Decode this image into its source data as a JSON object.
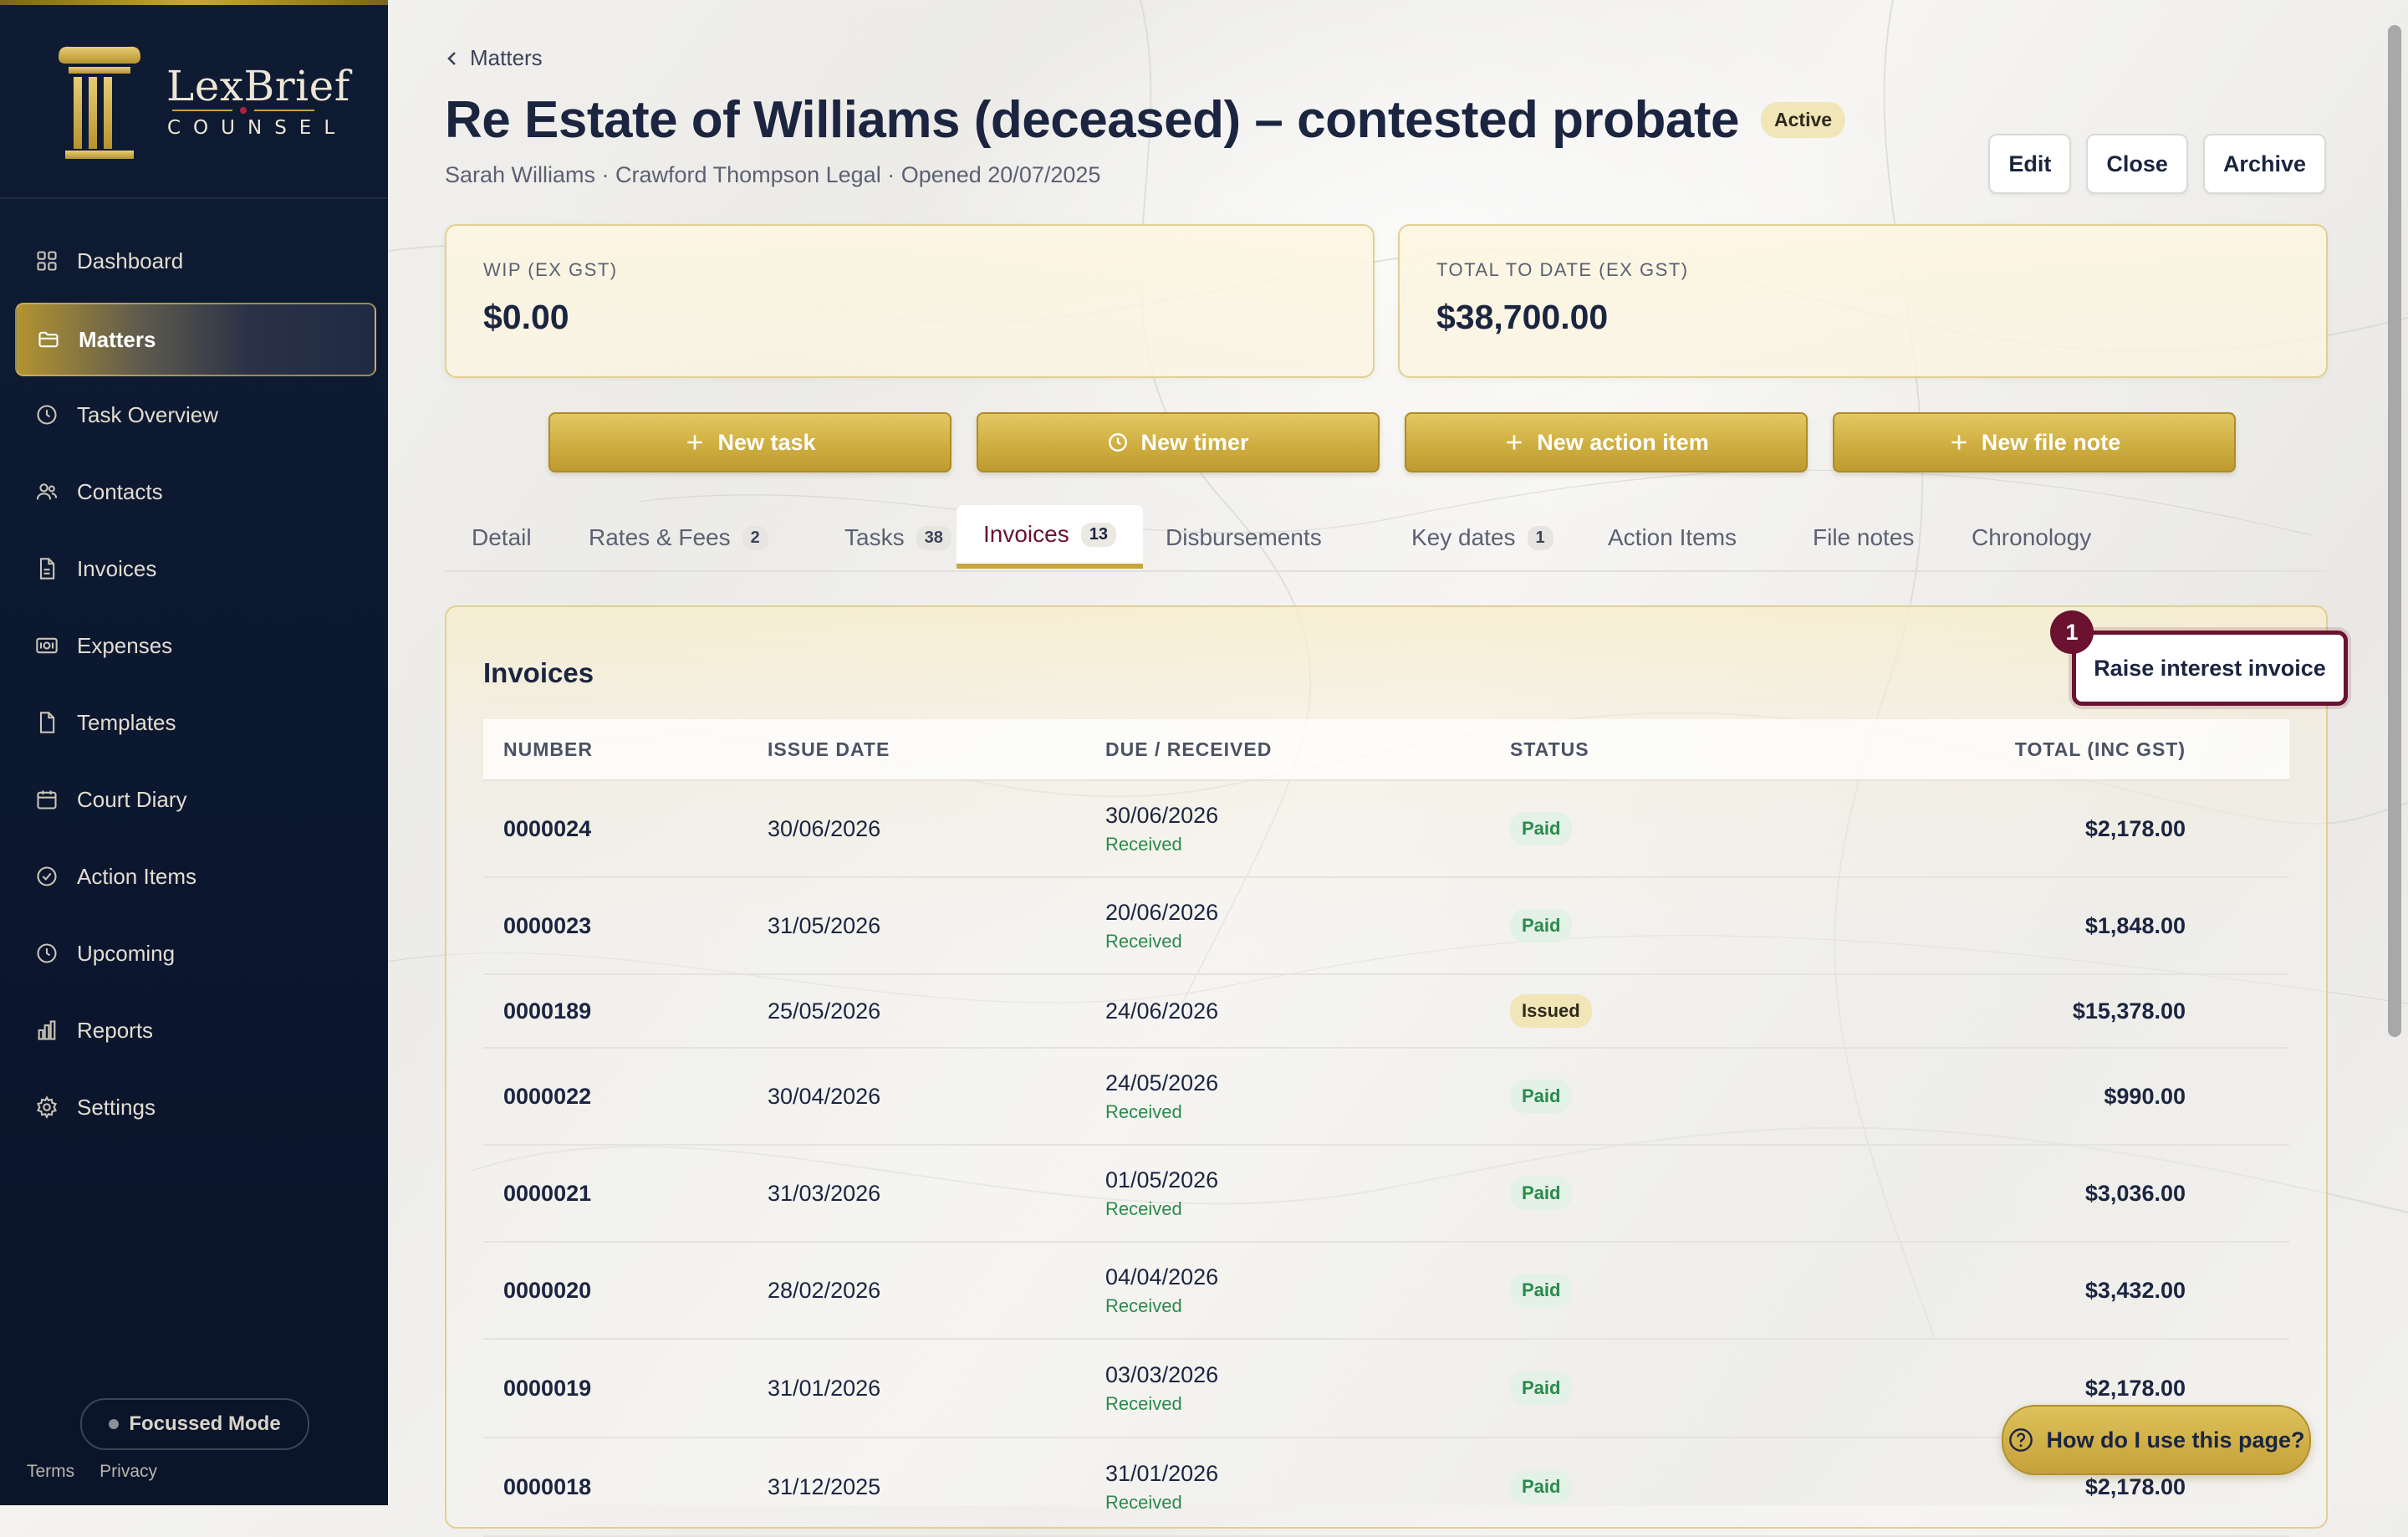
{
  "brand": {
    "name": "LexBrief",
    "sub": "COUNSEL"
  },
  "sidebar": {
    "items": [
      {
        "label": "Dashboard",
        "icon": "dashboard-icon"
      },
      {
        "label": "Matters",
        "icon": "folder-icon",
        "active": true
      },
      {
        "label": "Task Overview",
        "icon": "clock-icon"
      },
      {
        "label": "Contacts",
        "icon": "contacts-icon"
      },
      {
        "label": "Invoices",
        "icon": "invoice-icon"
      },
      {
        "label": "Expenses",
        "icon": "expenses-icon"
      },
      {
        "label": "Templates",
        "icon": "document-icon"
      },
      {
        "label": "Court Diary",
        "icon": "calendar-icon"
      },
      {
        "label": "Action Items",
        "icon": "check-circle-icon"
      },
      {
        "label": "Upcoming",
        "icon": "clock-icon"
      },
      {
        "label": "Reports",
        "icon": "bar-chart-icon"
      },
      {
        "label": "Settings",
        "icon": "gear-icon"
      }
    ],
    "focus_mode": "Focussed Mode",
    "terms": "Terms",
    "privacy": "Privacy"
  },
  "header": {
    "back_label": "Matters",
    "title": "Re Estate of Williams (deceased) – contested probate",
    "status": "Active",
    "subline": "Sarah Williams · Crawford Thompson Legal · Opened 20/07/2025",
    "edit": "Edit",
    "close": "Close",
    "archive": "Archive"
  },
  "stats": {
    "wip_label": "WIP (EX GST)",
    "wip_value": "$0.00",
    "total_label": "TOTAL TO DATE (EX GST)",
    "total_value": "$38,700.00"
  },
  "actions": {
    "new_task": "New task",
    "new_timer": "New timer",
    "new_action_item": "New action item",
    "new_file_note": "New file note"
  },
  "tabs": [
    {
      "label": "Detail",
      "count": ""
    },
    {
      "label": "Rates & Fees",
      "count": "2"
    },
    {
      "label": "Tasks",
      "count": "38"
    },
    {
      "label": "Invoices",
      "count": "13",
      "active": true
    },
    {
      "label": "Disbursements",
      "count": ""
    },
    {
      "label": "Key dates",
      "count": "1"
    },
    {
      "label": "Action Items",
      "count": ""
    },
    {
      "label": "File notes",
      "count": ""
    },
    {
      "label": "Chronology",
      "count": ""
    }
  ],
  "invoices": {
    "title": "Invoices",
    "raise_button": "Raise interest invoice",
    "marker": "1",
    "columns": [
      "NUMBER",
      "ISSUE DATE",
      "DUE / RECEIVED",
      "STATUS",
      "TOTAL (INC GST)"
    ],
    "rows": [
      {
        "number": "0000024",
        "issue": "30/06/2026",
        "due": "30/06/2026",
        "received": "Received",
        "status": "Paid",
        "total": "$2,178.00"
      },
      {
        "number": "0000023",
        "issue": "31/05/2026",
        "due": "20/06/2026",
        "received": "Received",
        "status": "Paid",
        "total": "$1,848.00"
      },
      {
        "number": "0000189",
        "issue": "25/05/2026",
        "due": "24/06/2026",
        "received": "",
        "status": "Issued",
        "total": "$15,378.00"
      },
      {
        "number": "0000022",
        "issue": "30/04/2026",
        "due": "24/05/2026",
        "received": "Received",
        "status": "Paid",
        "total": "$990.00"
      },
      {
        "number": "0000021",
        "issue": "31/03/2026",
        "due": "01/05/2026",
        "received": "Received",
        "status": "Paid",
        "total": "$3,036.00"
      },
      {
        "number": "0000020",
        "issue": "28/02/2026",
        "due": "04/04/2026",
        "received": "Received",
        "status": "Paid",
        "total": "$3,432.00"
      },
      {
        "number": "0000019",
        "issue": "31/01/2026",
        "due": "03/03/2026",
        "received": "Received",
        "status": "Paid",
        "total": "$2,178.00"
      },
      {
        "number": "0000018",
        "issue": "31/12/2025",
        "due": "31/01/2026",
        "received": "Received",
        "status": "Paid",
        "total": "$2,178.00"
      }
    ]
  },
  "help": {
    "label": "How do I use this page?"
  },
  "colors": {
    "navy": "#0f1b33",
    "gold": "#c9a53b",
    "maroon": "#6a1230",
    "paid_green": "#2a8a4c"
  }
}
